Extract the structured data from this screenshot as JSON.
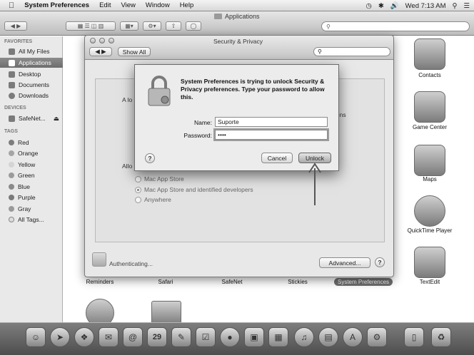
{
  "menubar": {
    "apple": "",
    "items": [
      "System Preferences",
      "Edit",
      "View",
      "Window",
      "Help"
    ],
    "clock": "Wed 7:13 AM",
    "icons": [
      "time-machine-icon",
      "bluetooth-icon",
      "volume-icon",
      "spotlight-icon",
      "notification-icon"
    ]
  },
  "finder": {
    "title": "Applications",
    "sidebar": {
      "favorites_header": "FAVORITES",
      "favorites": [
        "All My Files",
        "Applications",
        "Desktop",
        "Documents",
        "Downloads"
      ],
      "devices_header": "DEVICES",
      "devices": [
        "SafeNet..."
      ],
      "tags_header": "TAGS",
      "tags": [
        "Red",
        "Orange",
        "Yellow",
        "Green",
        "Blue",
        "Purple",
        "Gray",
        "All Tags..."
      ]
    },
    "apps_right": [
      "Contacts",
      "Game Center",
      "Maps",
      "QuickTime Player",
      "TextEdit"
    ],
    "apps_bottom": [
      "Reminders",
      "Safari",
      "SafeNet",
      "Stickies",
      "System Preferences"
    ]
  },
  "security_window": {
    "title": "Security & Privacy",
    "show_all": "Show All",
    "partial_a_lo": "A lo",
    "partial_allo": "Allo",
    "partial_gins": "gins",
    "radio_options": [
      "Mac App Store",
      "Mac App Store and identified developers",
      "Anywhere"
    ],
    "status": "Authenticating...",
    "advanced": "Advanced...",
    "help": "?"
  },
  "dialog": {
    "message": "System Preferences is trying to unlock Security & Privacy preferences. Type your password to allow this.",
    "name_label": "Name:",
    "name_value": "Suporte",
    "password_label": "Password:",
    "password_value": "••••",
    "cancel": "Cancel",
    "unlock": "Unlock",
    "help": "?"
  },
  "dock": {
    "items": [
      "finder-icon",
      "launchpad-icon",
      "safari-icon",
      "mail-icon",
      "contacts-icon",
      "calendar-icon",
      "notes-icon",
      "reminders-icon",
      "messages-icon",
      "facetime-icon",
      "photo-booth-icon",
      "itunes-icon",
      "ibooks-icon",
      "app-store-icon",
      "system-preferences-icon",
      "applications-folder-icon",
      "trash-icon"
    ],
    "calendar_day": "29"
  }
}
